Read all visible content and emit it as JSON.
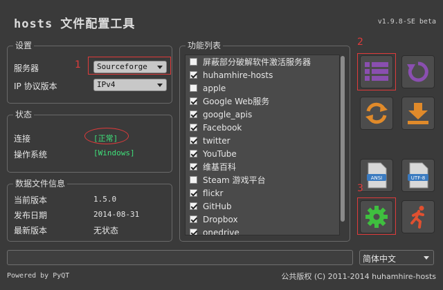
{
  "app": {
    "title": "hosts 文件配置工具",
    "version": "v1.9.8-SE beta"
  },
  "settings": {
    "legend": "设置",
    "server_label": "服务器",
    "server_value": "Sourceforge",
    "ip_label": "IP 协议版本",
    "ip_value": "IPv4"
  },
  "status": {
    "legend": "状态",
    "conn_label": "连接",
    "conn_value": "[正常]",
    "os_label": "操作系统",
    "os_value": "[Windows]"
  },
  "datafile": {
    "legend": "数据文件信息",
    "cur_label": "当前版本",
    "cur_value": "1.5.0",
    "date_label": "发布日期",
    "date_value": "2014-08-31",
    "latest_label": "最新版本",
    "latest_value": "无状态"
  },
  "functions": {
    "legend": "功能列表",
    "items": [
      {
        "label": "屏蔽部分破解软件激活服务器",
        "checked": false
      },
      {
        "label": "huhamhire-hosts",
        "checked": true
      },
      {
        "label": "apple",
        "checked": false
      },
      {
        "label": "Google Web服务",
        "checked": true
      },
      {
        "label": "google_apis",
        "checked": true
      },
      {
        "label": "Facebook",
        "checked": true
      },
      {
        "label": "twitter",
        "checked": true
      },
      {
        "label": "YouTube",
        "checked": true
      },
      {
        "label": "维基百科",
        "checked": true
      },
      {
        "label": "Steam 游戏平台",
        "checked": false
      },
      {
        "label": "flickr",
        "checked": true
      },
      {
        "label": "GitHub",
        "checked": true
      },
      {
        "label": "Dropbox",
        "checked": true
      },
      {
        "label": "onedrive",
        "checked": true
      }
    ]
  },
  "annotations": {
    "m1": "1",
    "m2": "2",
    "m3": "3"
  },
  "buttons": {
    "ansi_label": "ANSI",
    "utf8_label": "UTF-8"
  },
  "language": {
    "value": "简体中文"
  },
  "footer": {
    "powered": "Powered by PyQT",
    "copyright": "公共版权 (C) 2011-2014 huhamhire-hosts"
  },
  "colors": {
    "accent_purple": "#8a4fb0",
    "accent_orange": "#e08a2a",
    "green": "#3fe07a",
    "red_mark": "#e03b3b"
  }
}
